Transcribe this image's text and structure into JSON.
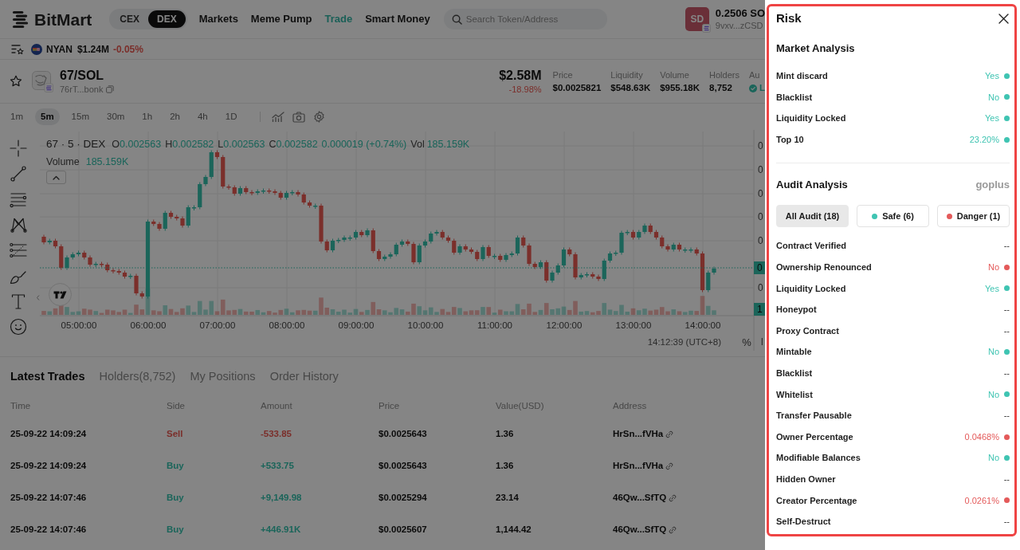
{
  "header": {
    "logo": "BitMart",
    "markets": [
      {
        "label": "CEX",
        "selected": false
      },
      {
        "label": "DEX",
        "selected": true
      }
    ],
    "nav": [
      {
        "label": "Markets",
        "selected": false
      },
      {
        "label": "Meme Pump",
        "selected": false
      },
      {
        "label": "Trade",
        "selected": true
      },
      {
        "label": "Smart Money",
        "selected": false
      }
    ],
    "search": {
      "placeholder": "Search Token/Address"
    },
    "wallet": {
      "avatar": "SD",
      "balance": "0.2506 SO",
      "address": "9vxv...zCSD"
    }
  },
  "ticker": {
    "symbol": "NYAN",
    "market_cap": "$1.24M",
    "change": "-0.05%"
  },
  "token": {
    "pair": "67/SOL",
    "address": "76rT...bonk",
    "market_cap": "$2.58M",
    "change": "-18.98%",
    "stats": [
      {
        "label": "Price",
        "value": "$0.0025821",
        "kind": "plain"
      },
      {
        "label": "Liquidity",
        "value": "$548.63K",
        "kind": "plain"
      },
      {
        "label": "Volume",
        "value": "$955.18K",
        "kind": "plain"
      },
      {
        "label": "Holders",
        "value": "8,752",
        "kind": "plain"
      },
      {
        "label": "Au",
        "value": "L",
        "kind": "verified"
      }
    ]
  },
  "chart": {
    "intervals": [
      {
        "label": "1m",
        "selected": false
      },
      {
        "label": "5m",
        "selected": true
      },
      {
        "label": "15m",
        "selected": false
      },
      {
        "label": "30m",
        "selected": false
      },
      {
        "label": "1h",
        "selected": false
      },
      {
        "label": "2h",
        "selected": false
      },
      {
        "label": "4h",
        "selected": false
      },
      {
        "label": "1D",
        "selected": false
      }
    ],
    "legend": {
      "title": "67 · 5 · DEX",
      "ohlc": [
        {
          "key": "O",
          "value": "0.002563"
        },
        {
          "key": "H",
          "value": "0.002582"
        },
        {
          "key": "L",
          "value": "0.002563"
        },
        {
          "key": "C",
          "value": "0.002582"
        }
      ],
      "change": "0.000019 (+0.74%)",
      "volume_key": "Vol",
      "volume_value": "185.159K"
    },
    "volume_legend": {
      "label": "Volume",
      "value": "185.159K"
    },
    "y_axis": [
      "0",
      "0",
      "0",
      "0",
      "0",
      "0"
    ],
    "price_tag": "0",
    "volume_tag": "1",
    "x_axis": [
      "05:00:00",
      "06:00:00",
      "07:00:00",
      "08:00:00",
      "09:00:00",
      "10:00:00",
      "11:00:00",
      "12:00:00",
      "13:00:00",
      "14:00:00"
    ],
    "clock": "14:12:39 (UTC+8)",
    "percent": "%",
    "log": "l"
  },
  "trades": {
    "tabs": [
      {
        "label": "Latest Trades",
        "selected": true
      },
      {
        "label": "Holders(8,752)",
        "selected": false
      },
      {
        "label": "My Positions",
        "selected": false
      },
      {
        "label": "Order History",
        "selected": false
      }
    ],
    "columns": [
      "Time",
      "Side",
      "Amount",
      "Price",
      "Value(USD)",
      "Address"
    ],
    "rows": [
      {
        "time": "25-09-22 14:09:24",
        "side": "Sell",
        "kind": "sell",
        "amount": "-533.85",
        "price": "$0.0025643",
        "value": "1.36",
        "address": "HrSn...fVHa"
      },
      {
        "time": "25-09-22 14:09:24",
        "side": "Buy",
        "kind": "buy",
        "amount": "+533.75",
        "price": "$0.0025643",
        "value": "1.36",
        "address": "HrSn...fVHa"
      },
      {
        "time": "25-09-22 14:07:46",
        "side": "Buy",
        "kind": "buy",
        "amount": "+9,149.98",
        "price": "$0.0025294",
        "value": "23.14",
        "address": "46Qw...SfTQ"
      },
      {
        "time": "25-09-22 14:07:46",
        "side": "Buy",
        "kind": "buy",
        "amount": "+446.91K",
        "price": "$0.0025607",
        "value": "1,144.42",
        "address": "46Qw...SfTQ"
      }
    ]
  },
  "risk": {
    "title": "Risk",
    "market": {
      "title": "Market Analysis",
      "rows": [
        {
          "label": "Mint discard",
          "value": "Yes",
          "color": "#3fc4b2"
        },
        {
          "label": "Blacklist",
          "value": "No",
          "color": "#3fc4b2"
        },
        {
          "label": "Liquidity Locked",
          "value": "Yes",
          "color": "#3fc4b2"
        },
        {
          "label": "Top 10",
          "value": "23.20%",
          "color": "#3fc4b2"
        }
      ]
    },
    "audit": {
      "title": "Audit Analysis",
      "source": "goplus",
      "filters": [
        {
          "label": "All Audit (18)",
          "selected": true
        },
        {
          "label": "Safe (6)",
          "selected": false,
          "color": "#3fc4b2"
        },
        {
          "label": "Danger (1)",
          "selected": false,
          "color": "#e45a5a"
        }
      ],
      "rows": [
        {
          "label": "Contract Verified",
          "value": "--"
        },
        {
          "label": "Ownership Renounced",
          "value": "No",
          "color": "#e45a5a"
        },
        {
          "label": "Liquidity Locked",
          "value": "Yes",
          "color": "#3fc4b2"
        },
        {
          "label": "Honeypot",
          "value": "--"
        },
        {
          "label": "Proxy Contract",
          "value": "--"
        },
        {
          "label": "Mintable",
          "value": "No",
          "color": "#3fc4b2"
        },
        {
          "label": "Blacklist",
          "value": "--"
        },
        {
          "label": "Whitelist",
          "value": "No",
          "color": "#3fc4b2"
        },
        {
          "label": "Transfer Pausable",
          "value": "--"
        },
        {
          "label": "Owner Percentage",
          "value": "0.0468%",
          "color": "#e45a5a"
        },
        {
          "label": "Modifiable Balances",
          "value": "No",
          "color": "#3fc4b2"
        },
        {
          "label": "Hidden Owner",
          "value": "--"
        },
        {
          "label": "Creator Percentage",
          "value": "0.0261%",
          "color": "#e45a5a"
        },
        {
          "label": "Self-Destruct",
          "value": "--"
        }
      ]
    }
  }
}
